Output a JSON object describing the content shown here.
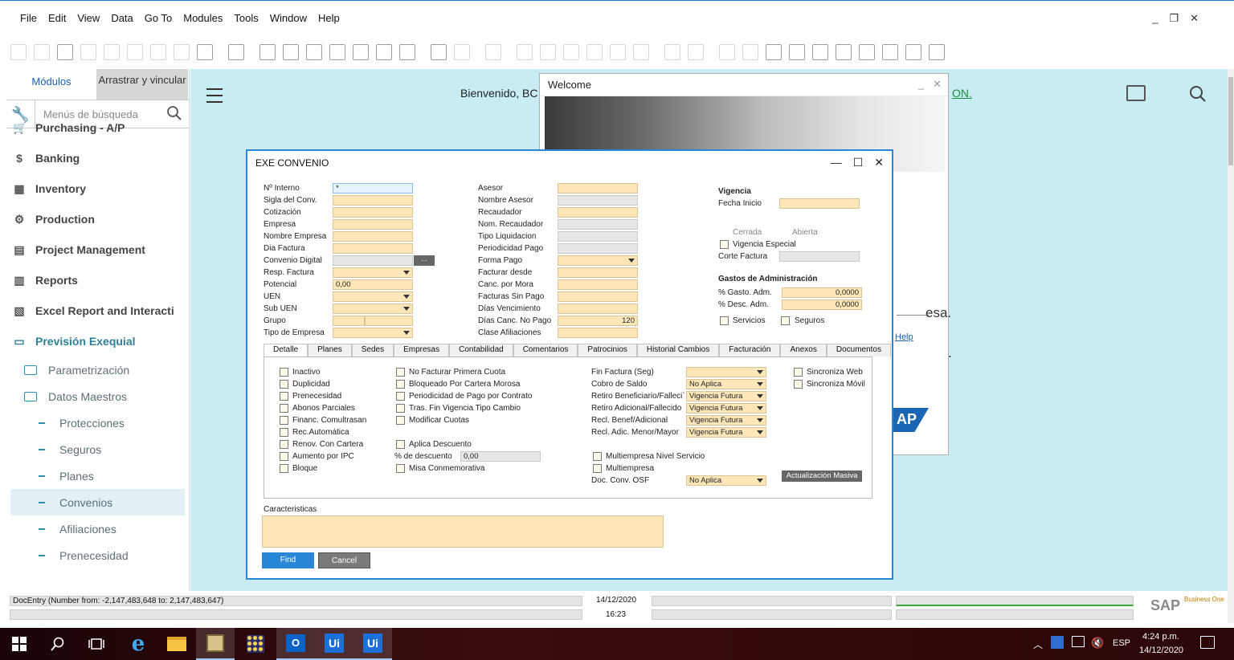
{
  "menubar": {
    "items": [
      "File",
      "Edit",
      "View",
      "Data",
      "Go To",
      "Modules",
      "Tools",
      "Window",
      "Help"
    ],
    "controls": [
      "_",
      "❐",
      "✕"
    ]
  },
  "toolbar": {
    "icons": [
      "print-preview-icon",
      "print-icon",
      "email-icon",
      "sms-icon",
      "fax-icon",
      "export-excel-icon",
      "export-word-icon",
      "export-pdf-icon",
      "navigate-icon",
      "layout-icon",
      "find-icon",
      "add-icon",
      "first-record-icon",
      "previous-record-icon",
      "next-record-icon",
      "last-record-icon",
      "refresh-icon",
      "filter-icon",
      "sort-icon",
      "base-document-icon",
      "target-document-icon",
      "gross-profit-icon",
      "payment-means-icon",
      "volume-weight-icon",
      "freight-icon",
      "journal-icon",
      "settings-icon",
      "form-settings-icon",
      "messages-icon",
      "alerts-icon",
      "calendar-icon",
      "org-icon",
      "user-icon",
      "transaction-icon",
      "widgets-icon",
      "remote-icon",
      "design-icon",
      "help-icon"
    ]
  },
  "leftpanel": {
    "tab_modules": "Módulos",
    "tab_drag": "Arrastrar y vincular",
    "search_placeholder": "Menús de búsqueda",
    "modules": [
      {
        "label": "Purchasing - A/P",
        "icon": "cart-icon"
      },
      {
        "label": "Banking",
        "icon": "dollar-icon"
      },
      {
        "label": "Inventory",
        "icon": "inventory-icon"
      },
      {
        "label": "Production",
        "icon": "production-icon"
      },
      {
        "label": "Project Management",
        "icon": "project-icon"
      },
      {
        "label": "Reports",
        "icon": "reports-icon"
      },
      {
        "label": "Excel Report and Interacti",
        "icon": "excel-icon"
      },
      {
        "label": "Previsión Exequial",
        "icon": "folder-icon"
      }
    ],
    "folders": [
      "Parametrización",
      "Datos Maestros"
    ],
    "leaves": [
      "Protecciones",
      "Seguros",
      "Planes",
      "Convenios",
      "Afiliaciones",
      "Prenecesidad"
    ]
  },
  "cockpit": {
    "welcome_text": "Bienvenido, BC",
    "link_text": "ON."
  },
  "welcome": {
    "title": "Welcome",
    "esa": "esa.",
    "help": "Help",
    "dot": ".",
    "sap": "AP"
  },
  "form": {
    "title": "EXE CONVENIO",
    "col1": {
      "labels": [
        "Nº Interno",
        "Sigla del Conv.",
        "Cotización",
        "Empresa",
        "Nombre Empresa",
        "Dia Factura",
        "Convenio Digital",
        "Resp. Factura",
        "Potencial",
        "UEN",
        "Sub UEN",
        "Grupo",
        "Tipo de Empresa"
      ],
      "interno_value": "*",
      "potencial_value": "0,00",
      "dots": "..."
    },
    "col2": {
      "labels": [
        "Asesor",
        "Nombre Asesor",
        "Recaudador",
        "Nom. Recaudador",
        "Tipo Liquidacion",
        "Periodicidad Pago",
        "Forma Pago",
        "Facturar desde",
        "Canc. por Mora",
        "Facturas Sin Pago",
        "Días Vencimiento",
        "Días Canc. No Pago",
        "Clase Afiliaciones"
      ],
      "dias_canc_value": "120"
    },
    "col3": {
      "vigencia": "Vigencia",
      "fecha_inicio": "Fecha Inicio",
      "cerrada": "Cerrada",
      "abierta": "Abierta",
      "vigencia_especial": "Vigencia Especial",
      "corte_factura": "Corte Factura",
      "gastos": "Gastos de Administración",
      "gasto_adm": "% Gasto. Adm.",
      "gasto_value": "0,0000",
      "desc_adm": "% Desc. Adm.",
      "desc_value": "0,0000",
      "servicios": "Servicios",
      "seguros": "Seguros"
    },
    "tabs": [
      "Detalle",
      "Planes",
      "Sedes",
      "Empresas",
      "Contabilidad",
      "Comentarios",
      "Patrocinios",
      "Historial Cambios",
      "Facturación",
      "Anexos",
      "Documentos"
    ],
    "detail": {
      "checks_a": [
        "Inactivo",
        "Duplicidad",
        "Prenecesidad",
        "Abonos Parciales",
        "Financ. Comultrasan",
        "Rec.Automática",
        "Renov. Con Cartera",
        "Aumento por IPC",
        "Bloque"
      ],
      "checks_b": [
        "No Facturar Primera Cuota",
        "Bloqueado Por Cartera Morosa",
        "Periodicidad de Pago por Contrato",
        "Tras. Fin Vigencia Tipo Cambio",
        "Modificar Cuotas"
      ],
      "aplica_descuento": "Aplica Descuento",
      "pct_descuento": "% de descuento",
      "pct_value": "0,00",
      "misa": "Misa Conmemorativa",
      "dd_labels": [
        "Fin Factura (Seg)",
        "Cobro de Saldo",
        "Retiro Beneficiario/Falleci`",
        "Retiro Adicional/Fallecido",
        "Recl. Benef/Adicional",
        "Recl. Adic. Menor/Mayor"
      ],
      "dd_values": [
        "",
        "No Aplica",
        "Vigencia Futura",
        "Vigencia Futura",
        "Vigencia Futura",
        "Vigencia Futura"
      ],
      "multi_servicio": "Multiempresa Nivel Servicio",
      "multiempresa": "Multiempresa",
      "doc_conv": "Doc. Conv. OSF",
      "doc_conv_value": "No Aplica",
      "sync_web": "Sincroniza Web",
      "sync_movil": "Sincroniza Móvil",
      "actualizacion": "Actualización Masiva"
    },
    "caracteristicas": "Caracteristicas",
    "find": "Find",
    "cancel": "Cancel"
  },
  "statusbar": {
    "docentry": "DocEntry (Number from: -2,147,483,648 to: 2,147,483,647)",
    "date": "14/12/2020",
    "time": "16:23",
    "brand": "SAP",
    "brand_sub": "Business One"
  },
  "taskbar": {
    "lang": "ESP",
    "clock_time": "4:24 p.m.",
    "clock_date": "14/12/2020"
  }
}
